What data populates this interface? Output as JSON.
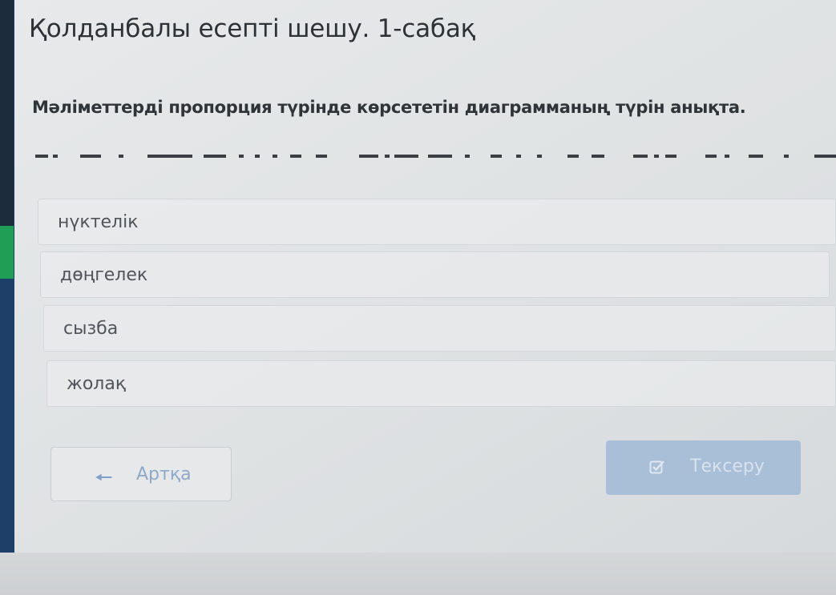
{
  "page": {
    "title": "Қолданбалы есепті шешу. 1-сабақ",
    "question": "Мәліметтерді пропорция түрінде көрсететін диаграмманың түрін анықта."
  },
  "options": [
    {
      "label": "нүктелік"
    },
    {
      "label": "дөңгелек"
    },
    {
      "label": "сызба"
    },
    {
      "label": "жолақ"
    }
  ],
  "buttons": {
    "back_label": "Артқа",
    "back_icon": "arrow-left-icon",
    "check_label": "Тексеру",
    "check_icon": "checkbox-check-icon"
  },
  "colors": {
    "sidebar": "#1e3f67",
    "sidebar_accent": "#1f9e55",
    "primary_button": "#a9bfd8"
  }
}
